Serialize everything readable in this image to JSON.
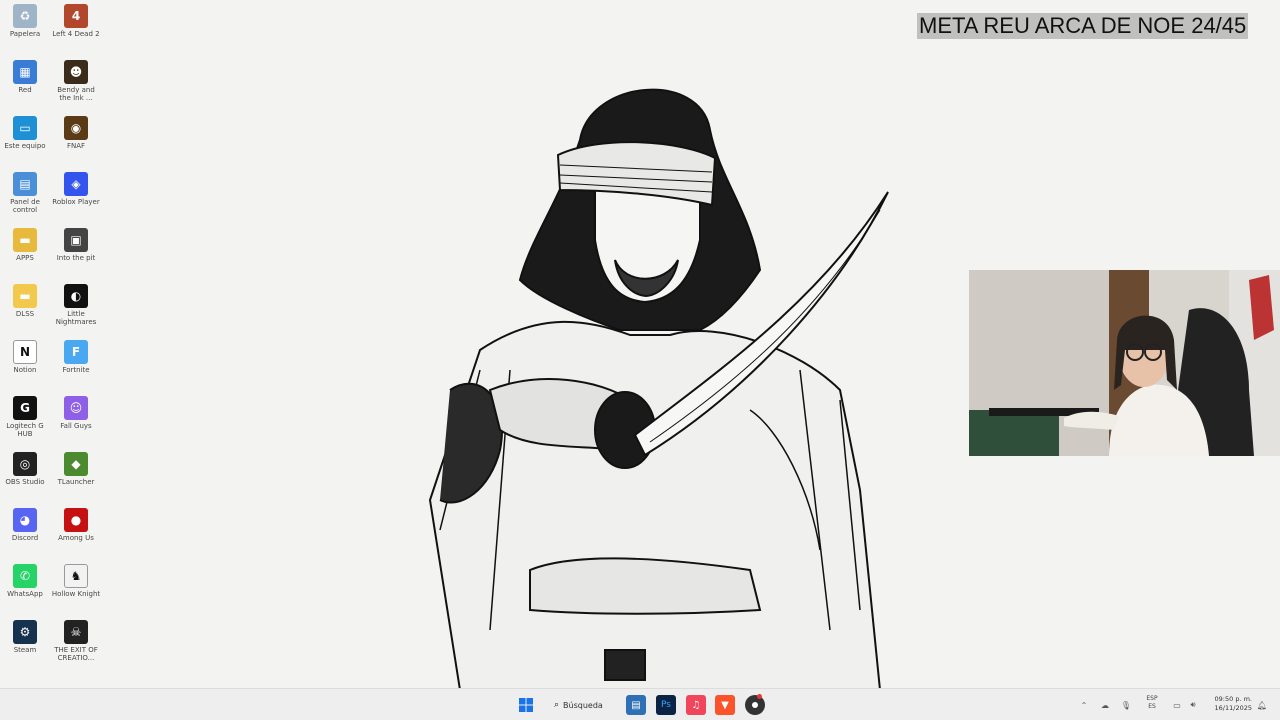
{
  "overlay": {
    "title": "META REU ARCA DE NOE 24/45"
  },
  "desktop": {
    "icons": [
      {
        "label": "Papelera",
        "icon": "recycle-bin-icon",
        "color": "#9fb4c8",
        "glyph": "♻"
      },
      {
        "label": "Left 4 Dead 2",
        "icon": "left4dead-icon",
        "color": "#b3472b",
        "glyph": "4"
      },
      {
        "label": "Red",
        "icon": "network-icon",
        "color": "#3a7bd5",
        "glyph": "▦"
      },
      {
        "label": "Bendy and the Ink ...",
        "icon": "bendy-icon",
        "color": "#3b2b1b",
        "glyph": "☻"
      },
      {
        "label": "Este equipo",
        "icon": "computer-icon",
        "color": "#1e90d6",
        "glyph": "▭"
      },
      {
        "label": "FNAF",
        "icon": "fnaf-icon",
        "color": "#5b3a16",
        "glyph": "◉"
      },
      {
        "label": "Panel de control",
        "icon": "control-panel-icon",
        "color": "#4a8fd8",
        "glyph": "▤"
      },
      {
        "label": "Roblox Player",
        "icon": "roblox-icon",
        "color": "#3355ee",
        "glyph": "◈"
      },
      {
        "label": "APPS",
        "icon": "folder-icon",
        "color": "#e7b93c",
        "glyph": "▬"
      },
      {
        "label": "Into the pit",
        "icon": "into-the-pit-icon",
        "color": "#444444",
        "glyph": "▣"
      },
      {
        "label": "DLSS",
        "icon": "folder-icon",
        "color": "#f2c94c",
        "glyph": "▬"
      },
      {
        "label": "Little Nightmares",
        "icon": "little-nightmares-icon",
        "color": "#111111",
        "glyph": "◐"
      },
      {
        "label": "Notion",
        "icon": "notion-icon",
        "color": "#ffffff",
        "glyph": "N"
      },
      {
        "label": "Fortnite",
        "icon": "fortnite-icon",
        "color": "#4aa8f0",
        "glyph": "F"
      },
      {
        "label": "Logitech G HUB",
        "icon": "logitech-icon",
        "color": "#111111",
        "glyph": "G"
      },
      {
        "label": "Fall Guys",
        "icon": "fall-guys-icon",
        "color": "#8f5fe8",
        "glyph": "☺"
      },
      {
        "label": "OBS Studio",
        "icon": "obs-icon",
        "color": "#222222",
        "glyph": "◎"
      },
      {
        "label": "TLauncher",
        "icon": "tlauncher-icon",
        "color": "#4c8a2f",
        "glyph": "◆"
      },
      {
        "label": "Discord",
        "icon": "discord-icon",
        "color": "#5865f2",
        "glyph": "◕"
      },
      {
        "label": "Among Us",
        "icon": "among-us-icon",
        "color": "#c51111",
        "glyph": "●"
      },
      {
        "label": "WhatsApp",
        "icon": "whatsapp-icon",
        "color": "#25d366",
        "glyph": "✆"
      },
      {
        "label": "Hollow Knight",
        "icon": "hollow-knight-icon",
        "color": "#f2f2f2",
        "glyph": "♞"
      },
      {
        "label": "Steam",
        "icon": "steam-icon",
        "color": "#17324f",
        "glyph": "⚙"
      },
      {
        "label": "THE EXIT OF CREATIO...",
        "icon": "game-icon",
        "color": "#222222",
        "glyph": "☠"
      }
    ]
  },
  "taskbar": {
    "search_label": "Búsqueda",
    "apps": [
      {
        "icon": "windows-start-icon",
        "color": "#1a73e8"
      },
      {
        "icon": "file-explorer-icon",
        "color": "#2f6fb5"
      },
      {
        "icon": "photoshop-icon",
        "color": "#0b2345"
      },
      {
        "icon": "itunes-icon",
        "color": "#f0455a"
      },
      {
        "icon": "brave-icon",
        "color": "#fb542b"
      },
      {
        "icon": "chrome-icon",
        "color": "#333333"
      }
    ],
    "lang_top": "ESP",
    "lang_bottom": "ES",
    "time": "09:50 p. m.",
    "date": "16/11/2025"
  }
}
